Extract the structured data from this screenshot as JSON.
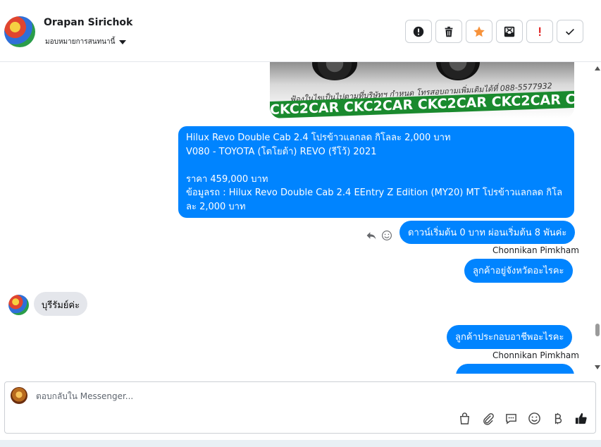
{
  "header": {
    "contact_name": "Orapan Sirichok",
    "assign_label": "มอบหมายการสนทนานี้",
    "actions": [
      {
        "name": "report-spam-button",
        "icon": "alert-icon"
      },
      {
        "name": "delete-button",
        "icon": "trash-icon"
      },
      {
        "name": "star-button",
        "icon": "star-icon"
      },
      {
        "name": "archive-button",
        "icon": "archive-icon"
      },
      {
        "name": "mark-follow-up-button",
        "icon": "exclamation-icon"
      },
      {
        "name": "mark-done-button",
        "icon": "check-icon"
      }
    ]
  },
  "chat": {
    "image_note": "ฟ้องในไขเป็นไปตามที่บริษัทฯ กำหนด โทรสอบถามเพิ่มเติมได้ที่ 088-5577932",
    "image_banner": "CKC2CAR CKC2CAR CKC2CAR CKC2CAR CKC2CAR CKC2",
    "car_message": {
      "line1": "Hilux Revo Double Cab 2.4 โปรข้าวแลกลด กิโลละ 2,000 บาท",
      "line2": "V080 - TOYOTA (โตโยต้า) REVO (รีโว้) 2021",
      "line3": "",
      "line4": "ราคา 459,000 บาท",
      "line5": "ข้อมูลรถ : Hilux Revo Double Cab 2.4 EEntry Z Edition (MY20) MT โปรข้าวแลกลด กิโลละ 2,000 บาท"
    },
    "msg_down_payment": "ดาวน์เริ่มต้น 0 บาท ผ่อนเริ่มต้น 8 พันค่ะ",
    "sender_1": "Chonnikan Pimkham",
    "msg_province_question": "ลูกค้าอยู่จังหวัดอะไรคะ",
    "msg_customer_reply": "บุรีรัมย์ค่ะ",
    "msg_occupation_question": "ลูกค้าประกอบอาชีพอะไรคะ",
    "sender_2": "Chonnikan Pimkham"
  },
  "composer": {
    "placeholder": "ตอบกลับใน Messenger...",
    "tools": [
      "bag-icon",
      "attachment-icon",
      "saved-reply-icon",
      "emoji-icon",
      "baht-icon",
      "thumbs-up-icon"
    ]
  },
  "colors": {
    "outgoing_bubble": "#0084ff",
    "incoming_bubble": "#e4e6eb",
    "star": "#f7923a",
    "follow_up": "#e02020",
    "thumbs_up": "#1c1e21"
  }
}
